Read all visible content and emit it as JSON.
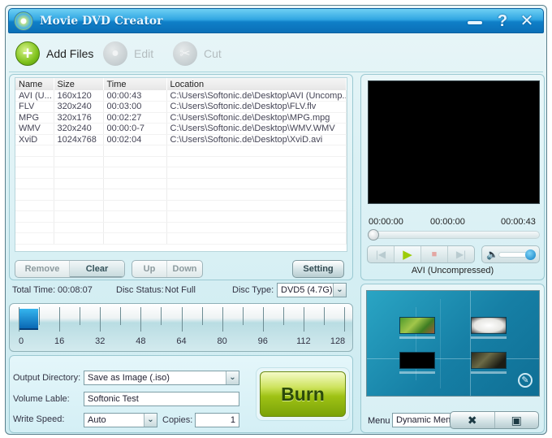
{
  "window": {
    "title": "Movie DVD Creator",
    "controls": {
      "minimize": "minimize-icon",
      "help": "?",
      "close": "✕"
    }
  },
  "toolbar": {
    "add_files": "Add Files",
    "edit": "Edit",
    "cut": "Cut",
    "add_icon": "+",
    "edit_icon": "●",
    "cut_icon": "✂"
  },
  "file_list": {
    "columns": [
      "Name",
      "Size",
      "Time",
      "Location"
    ],
    "rows": [
      {
        "name": "AVI (U...",
        "size": "160x120",
        "time": "00:00:43",
        "location": "C:\\Users\\Softonic.de\\Desktop\\AVI (Uncomp..."
      },
      {
        "name": "FLV",
        "size": "320x240",
        "time": "00:03:00",
        "location": "C:\\Users\\Softonic.de\\Desktop\\FLV.flv"
      },
      {
        "name": "MPG",
        "size": "320x176",
        "time": "00:02:27",
        "location": "C:\\Users\\Softonic.de\\Desktop\\MPG.mpg"
      },
      {
        "name": "WMV",
        "size": "320x240",
        "time": "00:00:0-7",
        "location": "C:\\Users\\Softonic.de\\Desktop\\WMV.WMV"
      },
      {
        "name": "XviD",
        "size": "1024x768",
        "time": "00:02:04",
        "location": "C:\\Users\\Softonic.de\\Desktop\\XviD.avi"
      }
    ],
    "buttons": {
      "remove": "Remove",
      "clear": "Clear",
      "up": "Up",
      "down": "Down",
      "setting": "Setting"
    }
  },
  "status": {
    "total_time_label": "Total Time:",
    "total_time": "00:08:07",
    "disc_status_label": "Disc Status:",
    "disc_status": "Not Full",
    "disc_type_label": "Disc Type:",
    "disc_type": "DVD5 (4.7G)"
  },
  "capacity": {
    "ticks": [
      "0",
      "16",
      "32",
      "48",
      "64",
      "80",
      "96",
      "112",
      "128"
    ],
    "used_fraction": 0.06
  },
  "output": {
    "output_dir_label": "Output Directory:",
    "output_dir": "Save as Image (.iso)",
    "volume_label_label": "Volume Lable:",
    "volume_label": "Softonic Test",
    "write_speed_label": "Write Speed:",
    "write_speed": "Auto",
    "copies_label": "Copies:",
    "copies": "1",
    "burn": "Burn"
  },
  "player": {
    "time_current": "00:00:00",
    "time_mid": "00:00:00",
    "time_total": "00:00:43",
    "clip_name": "AVI (Uncompressed)",
    "seek_fraction": 0.0,
    "volume_fraction": 1.0,
    "controls": {
      "prev": "|◀",
      "play": "▶",
      "stop": "■",
      "next": "▶|",
      "volume": "🔈"
    }
  },
  "menu": {
    "label": "Menu",
    "selected": "Dynamic Menu",
    "tools_icon": "✖",
    "page_icon": "▣"
  },
  "colors": {
    "titlebar": "#1a8fd6",
    "burn": "#9fc215",
    "accent_blue": "#0e7fc4"
  }
}
